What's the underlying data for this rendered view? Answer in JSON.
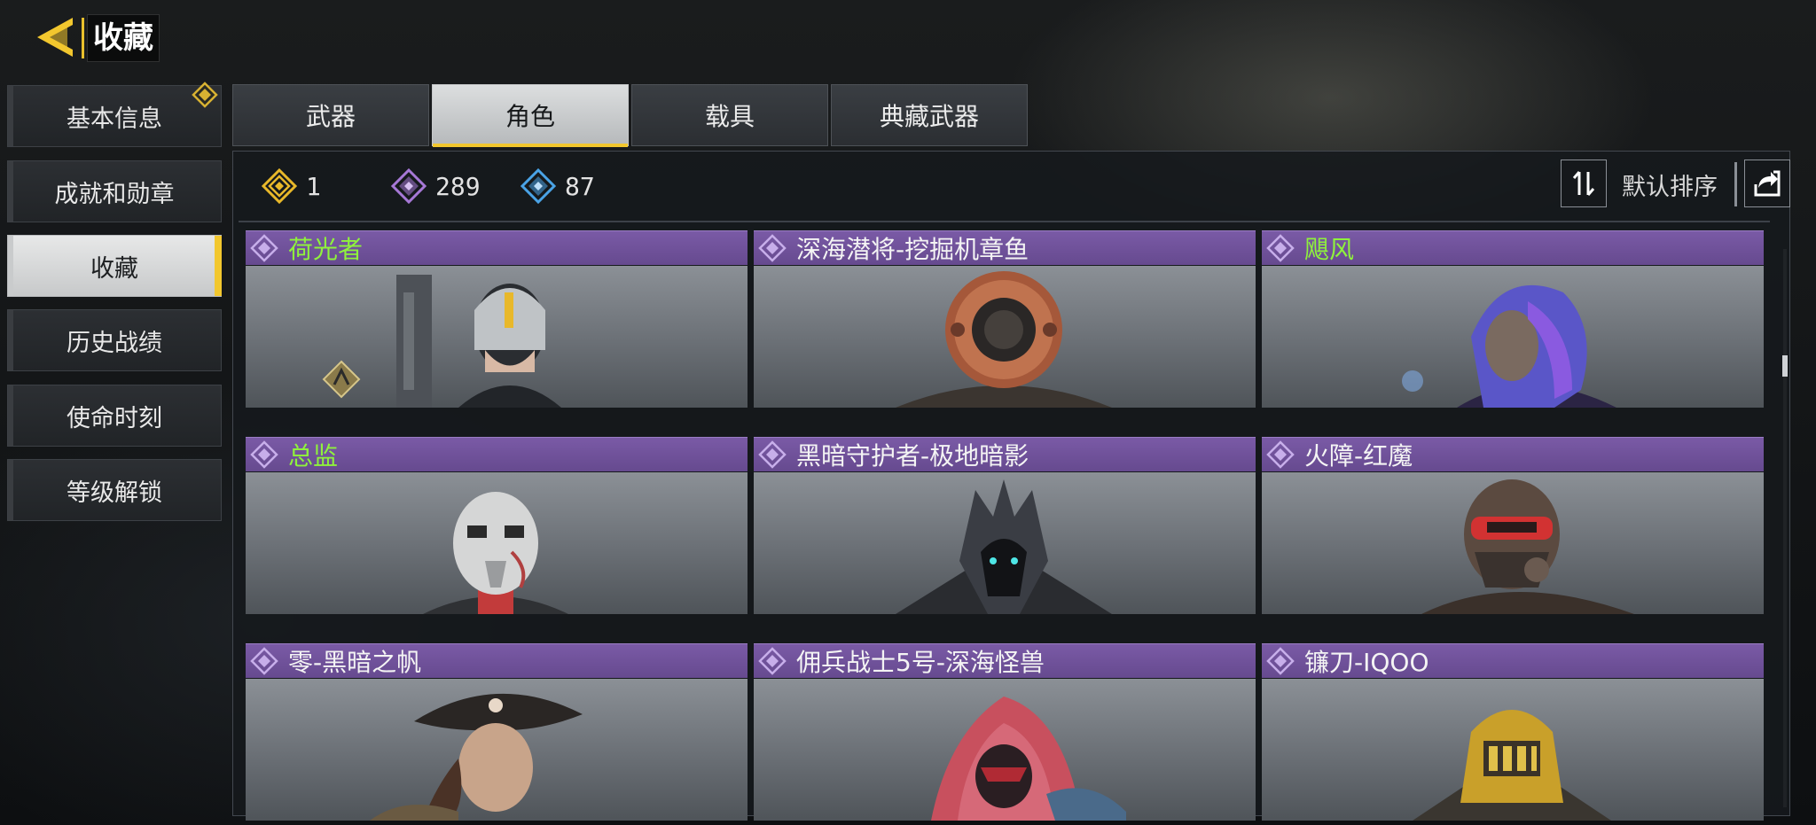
{
  "header": {
    "title": "收藏",
    "back_icon": "back-arrow-icon"
  },
  "sidebar": {
    "items": [
      {
        "label": "基本信息",
        "badge": "diamond-icon"
      },
      {
        "label": "成就和勋章"
      },
      {
        "label": "收藏",
        "active": true
      },
      {
        "label": "历史战绩"
      },
      {
        "label": "使命时刻"
      },
      {
        "label": "等级解锁"
      }
    ]
  },
  "tabs": [
    {
      "label": "武器"
    },
    {
      "label": "角色",
      "active": true
    },
    {
      "label": "载具"
    },
    {
      "label": "典藏武器"
    }
  ],
  "stats": {
    "legendary": "1",
    "epic": "289",
    "rare": "87"
  },
  "sort": {
    "label": "默认排序"
  },
  "cards": [
    {
      "name": "荷光者",
      "special": true
    },
    {
      "name": "深海潜将-挖掘机章鱼"
    },
    {
      "name": "飓风",
      "special": true
    },
    {
      "name": "总监",
      "special": true
    },
    {
      "name": "黑暗守护者-极地暗影"
    },
    {
      "name": "火障-红魔"
    },
    {
      "name": "零-黑暗之帆"
    },
    {
      "name": "佣兵战士5号-深海怪兽"
    },
    {
      "name": "镰刀-IQOO"
    }
  ],
  "colors": {
    "accent_gold": "#f2c72e",
    "card_purple": "#6e4f98",
    "special_name_green": "#8ff23c",
    "legendary_icon": "#e8b82a",
    "epic_icon": "#a678d6",
    "rare_icon": "#4aa3e6"
  }
}
